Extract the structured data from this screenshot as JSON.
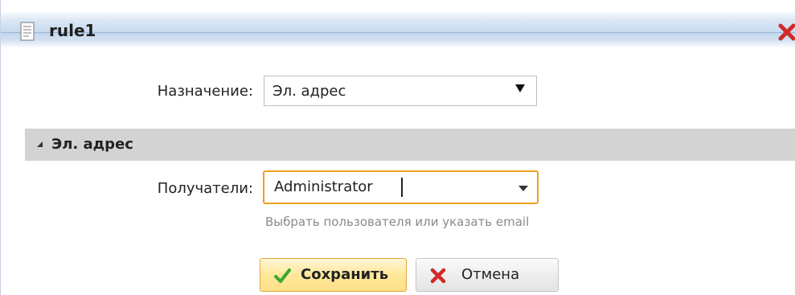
{
  "window": {
    "title": "rule1"
  },
  "form": {
    "purpose_label": "Назначение:",
    "purpose_value": "Эл. адрес"
  },
  "section": {
    "title": "Эл. адрес"
  },
  "recipients": {
    "label": "Получатели:",
    "value": "Administrator",
    "hint": "Выбрать пользователя или указать email"
  },
  "buttons": {
    "save_label": "Сохранить",
    "cancel_label": "Отмена"
  },
  "colors": {
    "focus_border": "#f0a020",
    "save_bg": "#ffe79b",
    "close_icon": "#d22a2a",
    "check_icon": "#3aa831",
    "section_bg": "#d3d3d3"
  },
  "icons": {
    "title_icon": "document-icon",
    "close_icon": "close-icon",
    "save_icon": "checkmark-icon",
    "cancel_icon": "cross-icon"
  }
}
